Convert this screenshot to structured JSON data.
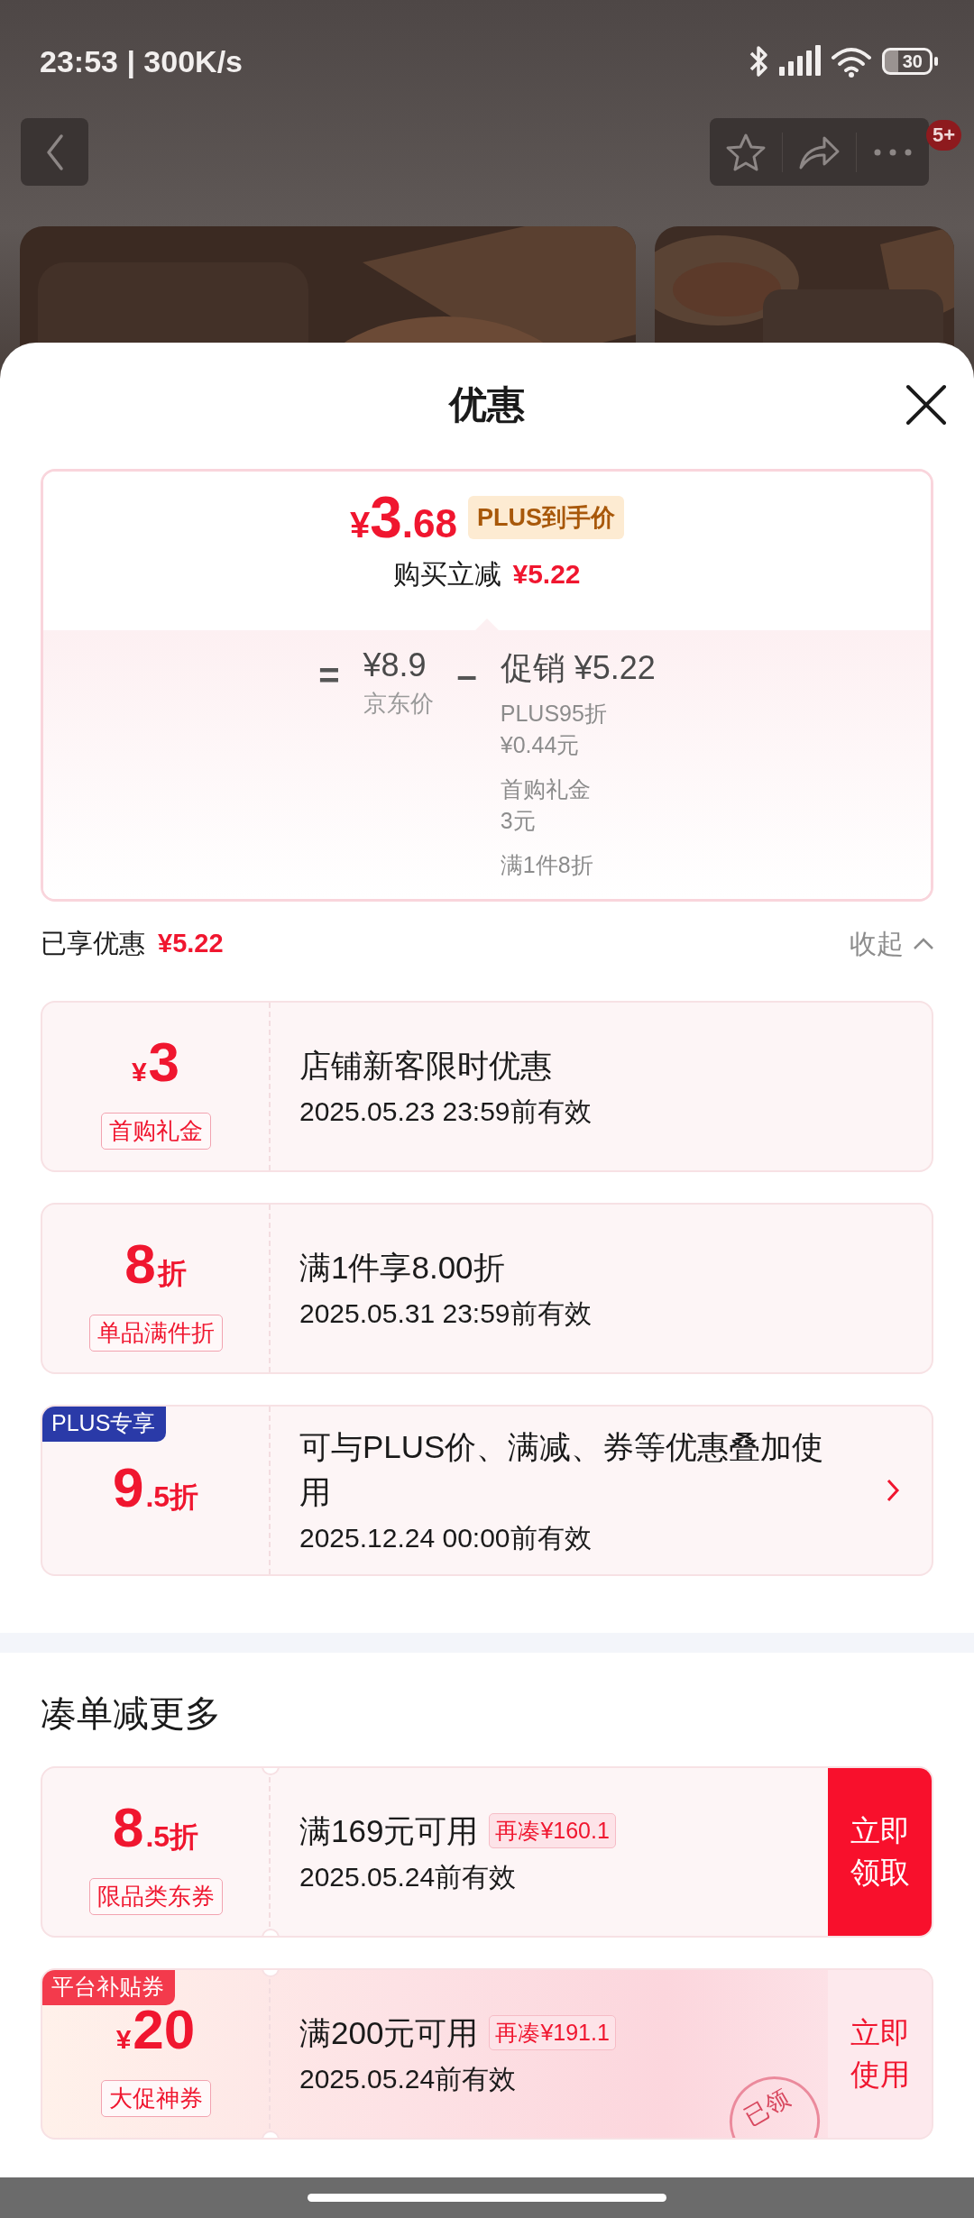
{
  "status_bar": {
    "time": "23:53 | 300K/s",
    "battery": "30"
  },
  "top_nav": {
    "notification_badge": "5+"
  },
  "sheet": {
    "title": "优惠"
  },
  "price_card": {
    "price_symbol": "¥",
    "price_int": "3",
    "price_decimal": ".68",
    "price_tag": "PLUS到手价",
    "saving_label": "购买立减",
    "saving_amount": "¥5.22",
    "equals_sign": "=",
    "base_price": "¥8.9",
    "base_label": "京东价",
    "minus_sign": "–",
    "promo_heading": "促销 ¥5.22",
    "promo_items": [
      {
        "name": "PLUS95折",
        "amount": "¥0.44元"
      },
      {
        "name": "首购礼金",
        "amount": "3元"
      },
      {
        "name": "满1件8折"
      }
    ]
  },
  "enjoyed": {
    "label": "已享优惠",
    "amount": "¥5.22",
    "toggle": "收起",
    "expanded": true
  },
  "coupons": [
    {
      "kind": "plain",
      "value_prefix": "¥",
      "value_main": "3",
      "type_label": "首购礼金",
      "title": "店铺新客限时优惠",
      "expiry": "2025.05.23 23:59前有效",
      "has_detail": false
    },
    {
      "kind": "plain",
      "value_main": "8",
      "value_suffix": "折",
      "type_label": "单品满件折",
      "title": "满1件享8.00折",
      "expiry": "2025.05.31 23:59前有效",
      "has_detail": false
    },
    {
      "kind": "plain",
      "corner_tag": {
        "text": "PLUS专享",
        "kind": "plus"
      },
      "value_main": "9",
      "value_suffix": ".5折",
      "title": "可与PLUS价、满减、券等优惠叠加使用",
      "expiry": "2025.12.24 00:00前有效",
      "has_detail": true
    }
  ],
  "more_section": {
    "title": "凑单减更多",
    "coupons": [
      {
        "kind": "ticket",
        "value_main": "8",
        "value_suffix": ".5折",
        "type_label": "限品类东券",
        "title": "满169元可用",
        "extra": "再凑¥160.1",
        "expiry": "2025.05.24前有效",
        "action": {
          "text": "立即领取",
          "kind": "filled"
        },
        "has_detail": false
      },
      {
        "kind": "promo",
        "corner_tag": {
          "text": "平台补贴券",
          "kind": "platform"
        },
        "value_prefix": "¥",
        "value_main": "20",
        "type_label": "大促神券",
        "title": "满200元可用",
        "extra": "再凑¥191.1",
        "expiry": "2025.05.24前有效",
        "action": {
          "text": "立即使用",
          "kind": "outline"
        },
        "stamp": "已领",
        "has_detail": false
      }
    ]
  }
}
